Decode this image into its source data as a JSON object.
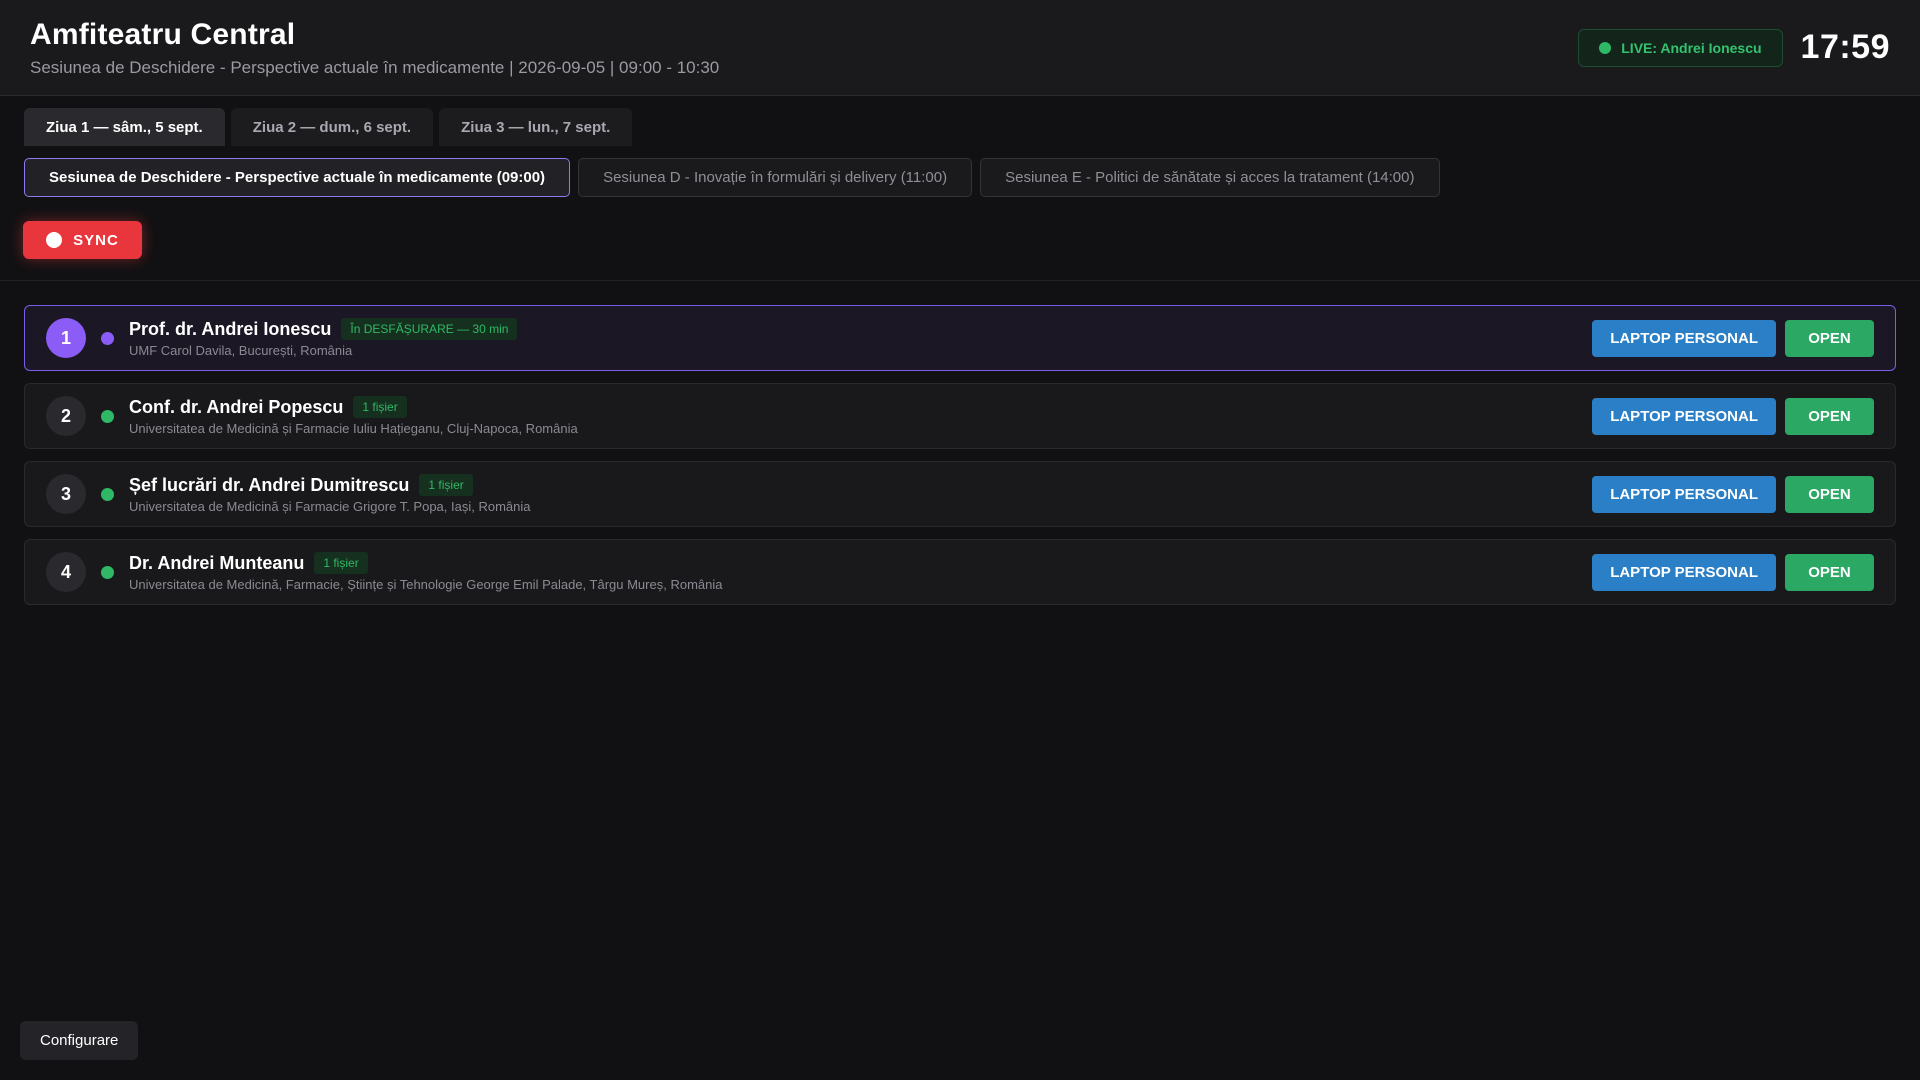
{
  "header": {
    "title": "Amfiteatru Central",
    "subtitle": "Sesiunea de Deschidere - Perspective actuale în medicamente | 2026-09-05 | 09:00 - 10:30",
    "live_label": "LIVE: Andrei Ionescu",
    "clock": "17:59"
  },
  "day_tabs": [
    {
      "label": "Ziua 1 — sâm., 5 sept."
    },
    {
      "label": "Ziua 2 — dum., 6 sept."
    },
    {
      "label": "Ziua 3 — lun., 7 sept."
    }
  ],
  "session_tabs": [
    {
      "label": "Sesiunea de Deschidere - Perspective actuale în medicamente (09:00)"
    },
    {
      "label": "Sesiunea D - Inovație în formulări și delivery (11:00)"
    },
    {
      "label": "Sesiunea E - Politici de sănătate și acces la tratament (14:00)"
    }
  ],
  "toolbar": {
    "sync_label": "SYNC"
  },
  "speakers": [
    {
      "num": "1",
      "name": "Prof. dr. Andrei Ionescu",
      "badge": "În DESFĂȘURARE — 30 min",
      "affiliation": "UMF Carol Davila, București, România",
      "laptop_label": "LAPTOP PERSONAL",
      "open_label": "OPEN"
    },
    {
      "num": "2",
      "name": "Conf. dr. Andrei Popescu",
      "badge": "1 fișier",
      "affiliation": "Universitatea de Medicină și Farmacie Iuliu Hațieganu, Cluj-Napoca, România",
      "laptop_label": "LAPTOP PERSONAL",
      "open_label": "OPEN"
    },
    {
      "num": "3",
      "name": "Șef lucrări dr. Andrei Dumitrescu",
      "badge": "1 fișier",
      "affiliation": "Universitatea de Medicină și Farmacie Grigore T. Popa, Iași, România",
      "laptop_label": "LAPTOP PERSONAL",
      "open_label": "OPEN"
    },
    {
      "num": "4",
      "name": "Dr. Andrei Munteanu",
      "badge": "1 fișier",
      "affiliation": "Universitatea de Medicină, Farmacie, Științe și Tehnologie George Emil Palade, Târgu Mureș, România",
      "laptop_label": "LAPTOP PERSONAL",
      "open_label": "OPEN"
    }
  ],
  "footer": {
    "config_label": "Configurare"
  },
  "colors": {
    "accent_purple": "#8b5cf6",
    "live_green": "#2fb866",
    "sync_red": "#e8363c",
    "laptop_blue": "#2b7fc6",
    "open_green": "#2aa864"
  }
}
